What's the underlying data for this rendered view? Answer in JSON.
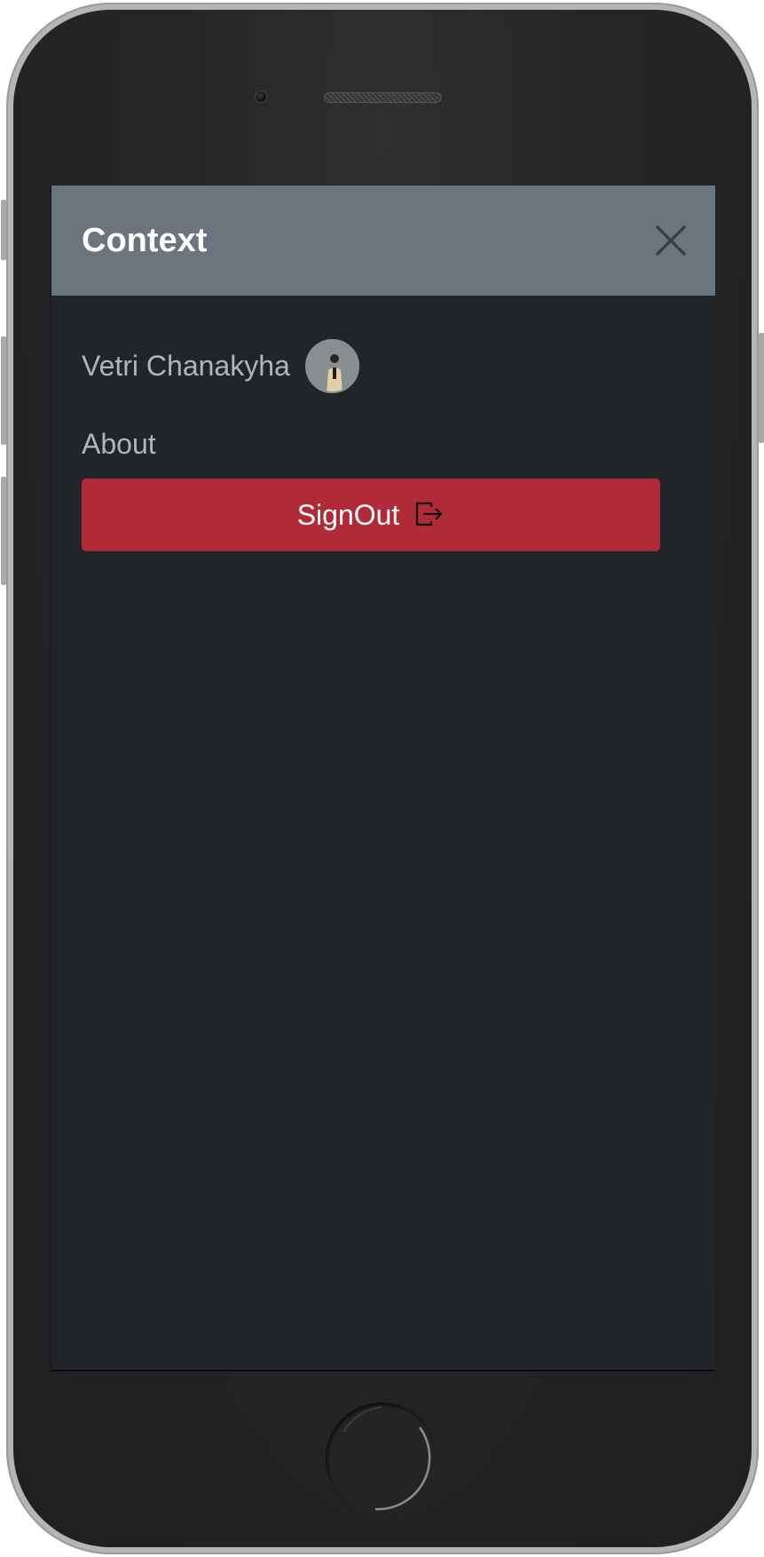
{
  "header": {
    "title": "Context"
  },
  "user": {
    "name": "Vetri Chanakyha"
  },
  "menu": {
    "about_label": "About",
    "signout_label": "SignOut"
  },
  "icons": {
    "close": "close-icon",
    "signout": "box-arrow-right-icon",
    "avatar": "user-avatar-photo"
  },
  "colors": {
    "header_bg": "#6c757d",
    "screen_bg": "#212529",
    "text_muted": "#adb5bd",
    "danger": "#b02a37"
  }
}
